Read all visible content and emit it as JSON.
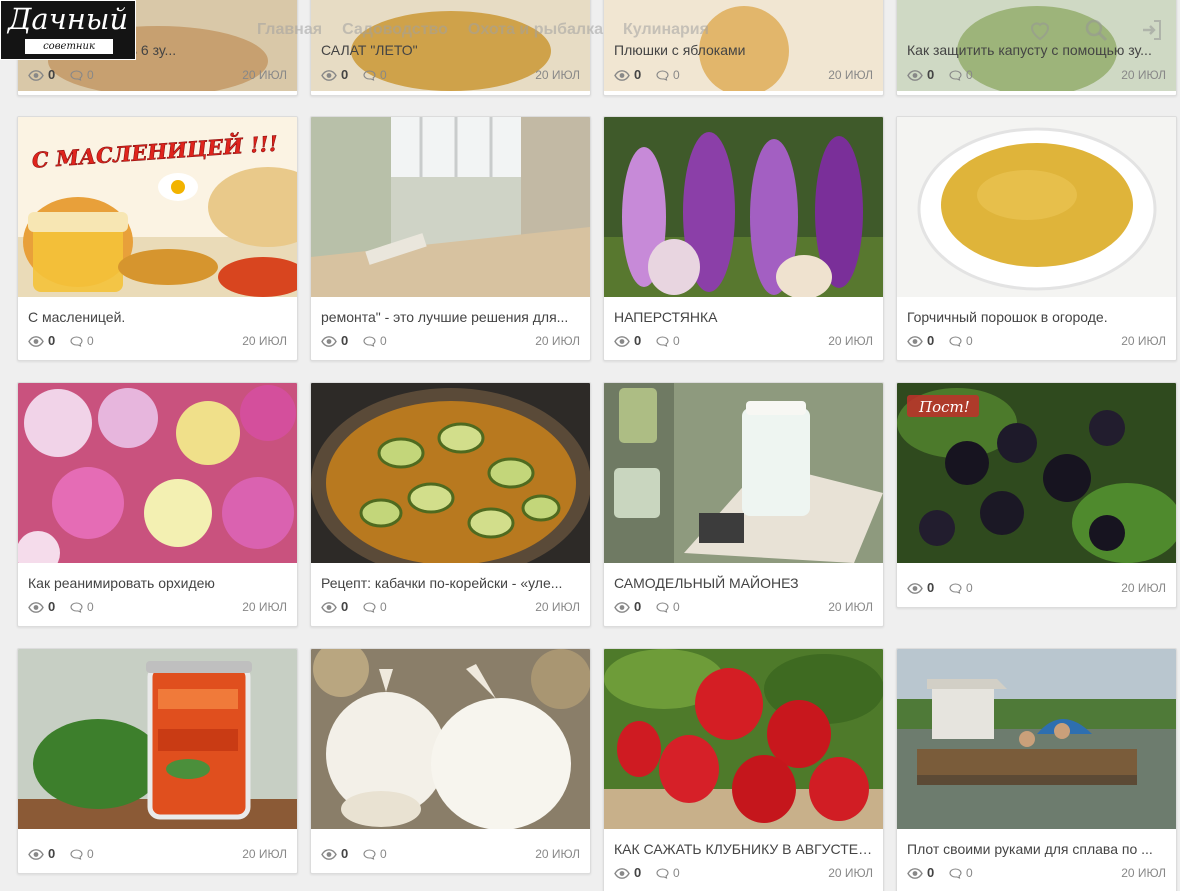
{
  "logo": {
    "title": "Дачный",
    "subtitle": "советник"
  },
  "nav": {
    "items": [
      "Главная",
      "Садоводство",
      "Охота и рыбалка",
      "Кулинария"
    ]
  },
  "top_icons": [
    "heart-icon",
    "search-icon",
    "login-icon"
  ],
  "cards": [
    {
      "title": "...одимо съедать 6 зу...",
      "views": "0",
      "comments": "0",
      "date": "20 ИЮЛ",
      "image": "food-plate"
    },
    {
      "title": "САЛАТ \"ЛЕТО\"",
      "views": "0",
      "comments": "0",
      "date": "20 ИЮЛ",
      "image": "salad"
    },
    {
      "title": "Плюшки с яблоками",
      "views": "0",
      "comments": "0",
      "date": "20 ИЮЛ",
      "image": "buns"
    },
    {
      "title": "Как защитить капусту с помощью зу...",
      "views": "0",
      "comments": "0",
      "date": "20 ИЮЛ",
      "image": "cabbage"
    },
    {
      "title": "С масленицей.",
      "views": "0",
      "comments": "0",
      "date": "20 ИЮЛ",
      "image": "maslenitsa",
      "banner": "С МАСЛЕНИЦЕЙ !!!"
    },
    {
      "title": "ремонта\" - это лучшие решения для...",
      "views": "0",
      "comments": "0",
      "date": "20 ИЮЛ",
      "image": "balcony"
    },
    {
      "title": "НАПЕРСТЯНКА",
      "views": "0",
      "comments": "0",
      "date": "20 ИЮЛ",
      "image": "foxglove"
    },
    {
      "title": "Горчичный порошок в огороде.",
      "views": "0",
      "comments": "0",
      "date": "20 ИЮЛ",
      "image": "mustard"
    },
    {
      "title": "Как реанимировать орхидею",
      "views": "0",
      "comments": "0",
      "date": "20 ИЮЛ",
      "image": "orchids"
    },
    {
      "title": "Рецепт: кабачки по-корейски - «уле...",
      "views": "0",
      "comments": "0",
      "date": "20 ИЮЛ",
      "image": "zucchini"
    },
    {
      "title": "САМОДЕЛЬНЫЙ МАЙОНЕЗ",
      "views": "0",
      "comments": "0",
      "date": "20 ИЮЛ",
      "image": "mayonnaise"
    },
    {
      "title": "",
      "views": "0",
      "comments": "0",
      "date": "20 ИЮЛ",
      "image": "blackberry",
      "stamp": "Пост!"
    },
    {
      "title": "",
      "views": "0",
      "comments": "0",
      "date": "20 ИЮЛ",
      "image": "pepper-jar"
    },
    {
      "title": "",
      "views": "0",
      "comments": "0",
      "date": "20 ИЮЛ",
      "image": "garlic"
    },
    {
      "title": "КАК САЖАТЬ КЛУБНИКУ В АВГУСТЕ, ...",
      "views": "0",
      "comments": "0",
      "date": "20 ИЮЛ",
      "image": "strawberry"
    },
    {
      "title": "Плот своими руками для сплава по ...",
      "views": "0",
      "comments": "0",
      "date": "20 ИЮЛ",
      "image": "raft"
    }
  ]
}
